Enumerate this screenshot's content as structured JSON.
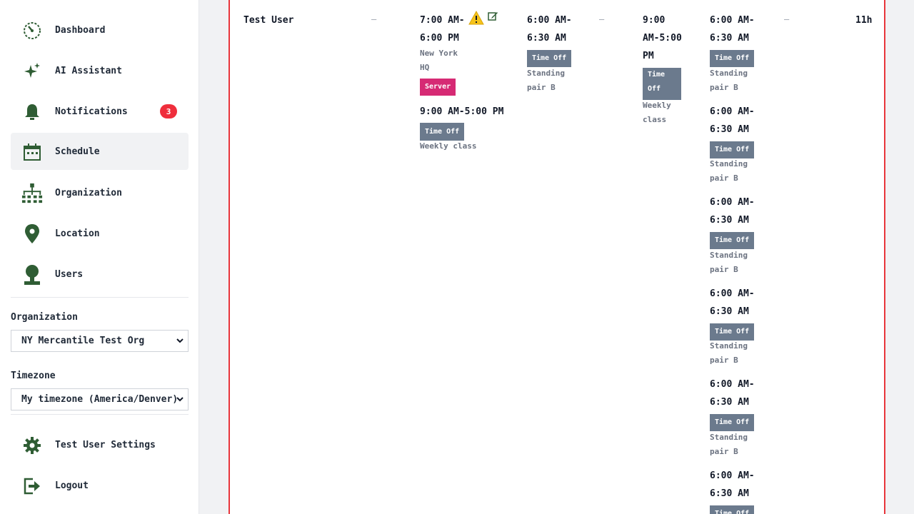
{
  "sidebar": {
    "items": [
      {
        "label": "Dashboard",
        "icon": "dashboard-gauge-icon"
      },
      {
        "label": "AI Assistant",
        "icon": "sparkle-icon"
      },
      {
        "label": "Notifications",
        "icon": "bell-icon",
        "badge": "3"
      },
      {
        "label": "Schedule",
        "icon": "calendar-icon",
        "active": true
      },
      {
        "label": "Organization",
        "icon": "org-chart-icon"
      },
      {
        "label": "Location",
        "icon": "map-pin-icon"
      },
      {
        "label": "Users",
        "icon": "user-icon"
      }
    ],
    "organization_label": "Organization",
    "organization_value": "NY Mercantile Test Org",
    "timezone_label": "Timezone",
    "timezone_value": "My timezone (America/Denver)",
    "settings_label": "Test User Settings",
    "logout_label": "Logout"
  },
  "colors": {
    "icon_green": "#2f5d34",
    "badge_red": "#ef2e3c",
    "panel_border": "#e8363c",
    "timeoff_tag": "#6b7a8d",
    "server_tag": "#d62a74"
  },
  "schedule": {
    "row_user": "Test User",
    "empty": "–",
    "total": "11h",
    "col_a": {
      "shift1_time_line1": "7:00 AM-",
      "shift1_time_line2": "6:00 PM",
      "shift1_location_line1": "New York",
      "shift1_location_line2": "HQ",
      "shift1_tag": "Server",
      "shift2_time": "9:00 AM-5:00 PM",
      "shift2_tag": "Time Off",
      "shift2_note": "Weekly class"
    },
    "col_b": {
      "time_line1": "6:00 AM-",
      "time_line2": "6:30 AM",
      "tag": "Time Off",
      "note_line1": "Standing",
      "note_line2": "pair B"
    },
    "col_c": {
      "time_line1": "9:00",
      "time_line2": "AM-5:00",
      "time_line3": "PM",
      "tag_line1": "Time",
      "tag_line2": "Off",
      "note_line1": "Weekly",
      "note_line2": "class"
    },
    "col_d": {
      "entries": [
        {
          "time_line1": "6:00 AM-",
          "time_line2": "6:30 AM",
          "tag": "Time Off",
          "note_line1": "Standing",
          "note_line2": "pair B"
        },
        {
          "time_line1": "6:00 AM-",
          "time_line2": "6:30 AM",
          "tag": "Time Off",
          "note_line1": "Standing",
          "note_line2": "pair B"
        },
        {
          "time_line1": "6:00 AM-",
          "time_line2": "6:30 AM",
          "tag": "Time Off",
          "note_line1": "Standing",
          "note_line2": "pair B"
        },
        {
          "time_line1": "6:00 AM-",
          "time_line2": "6:30 AM",
          "tag": "Time Off",
          "note_line1": "Standing",
          "note_line2": "pair B"
        },
        {
          "time_line1": "6:00 AM-",
          "time_line2": "6:30 AM",
          "tag": "Time Off",
          "note_line1": "Standing",
          "note_line2": "pair B"
        },
        {
          "time_line1": "6:00 AM-",
          "time_line2": "6:30 AM",
          "tag": "Time Off"
        }
      ]
    }
  }
}
